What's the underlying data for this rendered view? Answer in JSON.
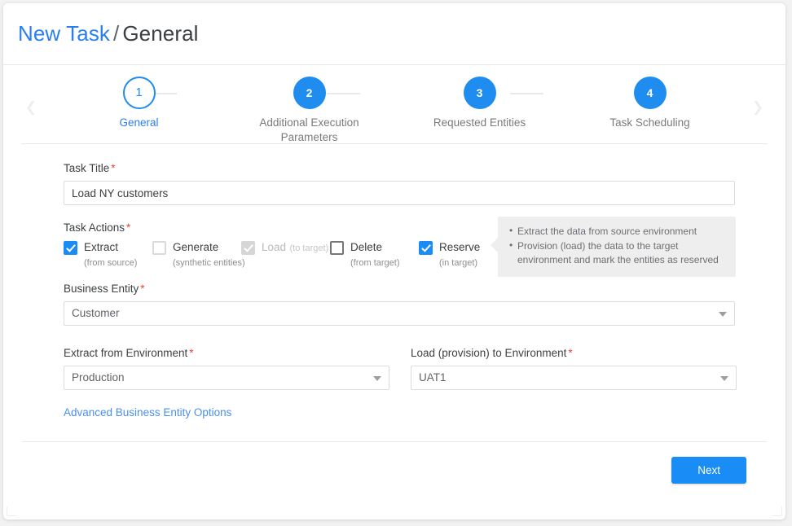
{
  "header": {
    "breadcrumb_link": "New Task",
    "breadcrumb_separator": "/",
    "breadcrumb_current": "General"
  },
  "stepper": {
    "prev_icon": "chevron-left-icon",
    "next_icon": "chevron-right-icon",
    "steps": [
      {
        "number": "1",
        "label": "General",
        "state": "current"
      },
      {
        "number": "2",
        "label": "Additional Execution Parameters",
        "state": "upcoming"
      },
      {
        "number": "3",
        "label": "Requested Entities",
        "state": "upcoming"
      },
      {
        "number": "4",
        "label": "Task Scheduling",
        "state": "upcoming"
      }
    ]
  },
  "form": {
    "task_title": {
      "label": "Task Title",
      "required_mark": "*",
      "value": "Load NY customers",
      "placeholder": "Task Title"
    },
    "task_actions": {
      "label": "Task Actions",
      "required_mark": "*",
      "items": [
        {
          "name": "Extract",
          "sub": "(from source)",
          "checked": true,
          "disabled": false
        },
        {
          "name": "Generate",
          "sub": "(synthetic entities)",
          "checked": false,
          "disabled": false
        },
        {
          "name": "Load",
          "sub": "(to target)",
          "checked": true,
          "disabled": true
        },
        {
          "name": "Delete",
          "sub": "(from target)",
          "checked": false,
          "disabled": false
        },
        {
          "name": "Reserve",
          "sub": "(in target)",
          "checked": true,
          "disabled": false
        }
      ]
    },
    "info_box": {
      "lines": [
        "Extract the data from source environment",
        "Provision (load) the data to the target environment and mark the entities as reserved"
      ]
    },
    "business_entity": {
      "label": "Business Entity",
      "required_mark": "*",
      "value": "Customer",
      "caret_icon": "chevron-down-icon"
    },
    "extract_environment": {
      "label": "Extract from Environment",
      "required_mark": "*",
      "value": "Production",
      "caret_icon": "chevron-down-icon"
    },
    "load_environment": {
      "label": "Load (provision) to Environment",
      "required_mark": "*",
      "value": "UAT1",
      "caret_icon": "chevron-down-icon"
    },
    "advanced_link": "Advanced Business Entity Options"
  },
  "footer": {
    "next_label": "Next"
  },
  "colors": {
    "accent_blue": "#1a8cf5",
    "link_blue": "#2a7ff0",
    "required_red": "#ea4335",
    "info_bg": "#eeeeee",
    "text_primary": "#3c4043",
    "text_muted": "#7a7a7a"
  }
}
